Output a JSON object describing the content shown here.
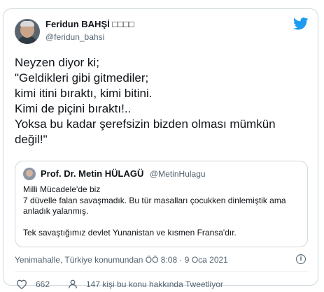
{
  "author": {
    "name": "Feridun BAHŞİ □□□□",
    "handle": "@feridun_bahsi"
  },
  "tweet": {
    "text": "Neyzen diyor ki;\n\"Geldikleri gibi gitmediler;\nkimi itini bıraktı, kimi bitini.\nKimi de piçini bıraktı!..\nYoksa bu kadar şerefsizin bizden olması mümkün değil!\""
  },
  "quoted": {
    "name": "Prof. Dr. Metin HÜLAGÜ",
    "handle": "@MetinHulagu",
    "text": "Milli Mücadele'de biz\n7 düvelle falan savaşmadık. Bu tür masalları çocukken dinlemiştik ama anladık yalanmış.\n\nTek savaştığımız devlet Yunanistan ve kısmen Fransa'dır."
  },
  "meta": {
    "location_time": "Yenimahalle, Türkiye konumundan ÖÖ 8:08 · 9 Oca 2021",
    "info_symbol": "i"
  },
  "actions": {
    "likes": "662",
    "replies_text": "147 kişi bu konu hakkında Tweetliyor"
  },
  "colors": {
    "twitter_blue": "#1d9bf0",
    "like_red": "#f91880",
    "secondary_text": "#536471"
  }
}
